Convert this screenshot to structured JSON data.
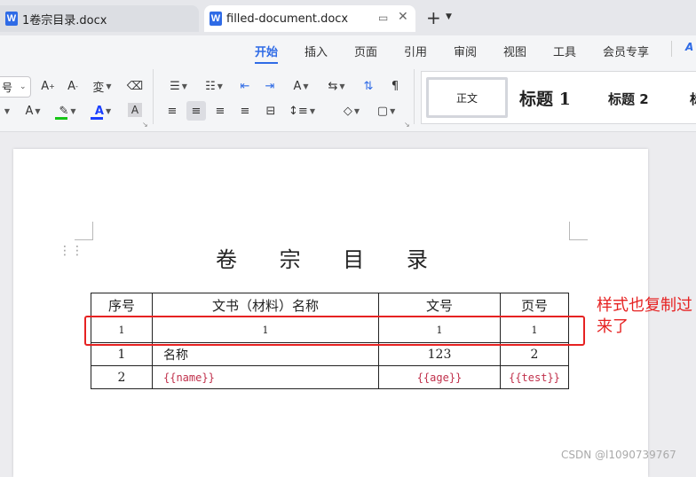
{
  "tabs": [
    {
      "label": "1卷宗目录.docx",
      "active": false
    },
    {
      "label": "filled-document.docx",
      "active": true
    }
  ],
  "menu": [
    "开始",
    "插入",
    "页面",
    "引用",
    "审阅",
    "视图",
    "工具",
    "会员专享"
  ],
  "toolbar": {
    "font_size_value": "号",
    "styles": {
      "normal": "正文",
      "h1": "标题 1",
      "h2": "标题 2",
      "h3": "标"
    }
  },
  "document": {
    "title": "卷 宗 目 录",
    "table": {
      "headers": [
        "序号",
        "文书（材料）名称",
        "文号",
        "页号"
      ],
      "rows": [
        [
          "1",
          "1",
          "1",
          "1"
        ],
        [
          "1",
          "名称",
          "123",
          "2"
        ],
        [
          "2",
          "{{name}}",
          "{{age}}",
          "{{test}}"
        ]
      ]
    }
  },
  "annotation": "样式也复制过来了",
  "watermark": "CSDN @l1090739767",
  "colors": {
    "accent": "#2f6be6",
    "annotation": "#e62222",
    "placeholder": "#c0304b"
  }
}
